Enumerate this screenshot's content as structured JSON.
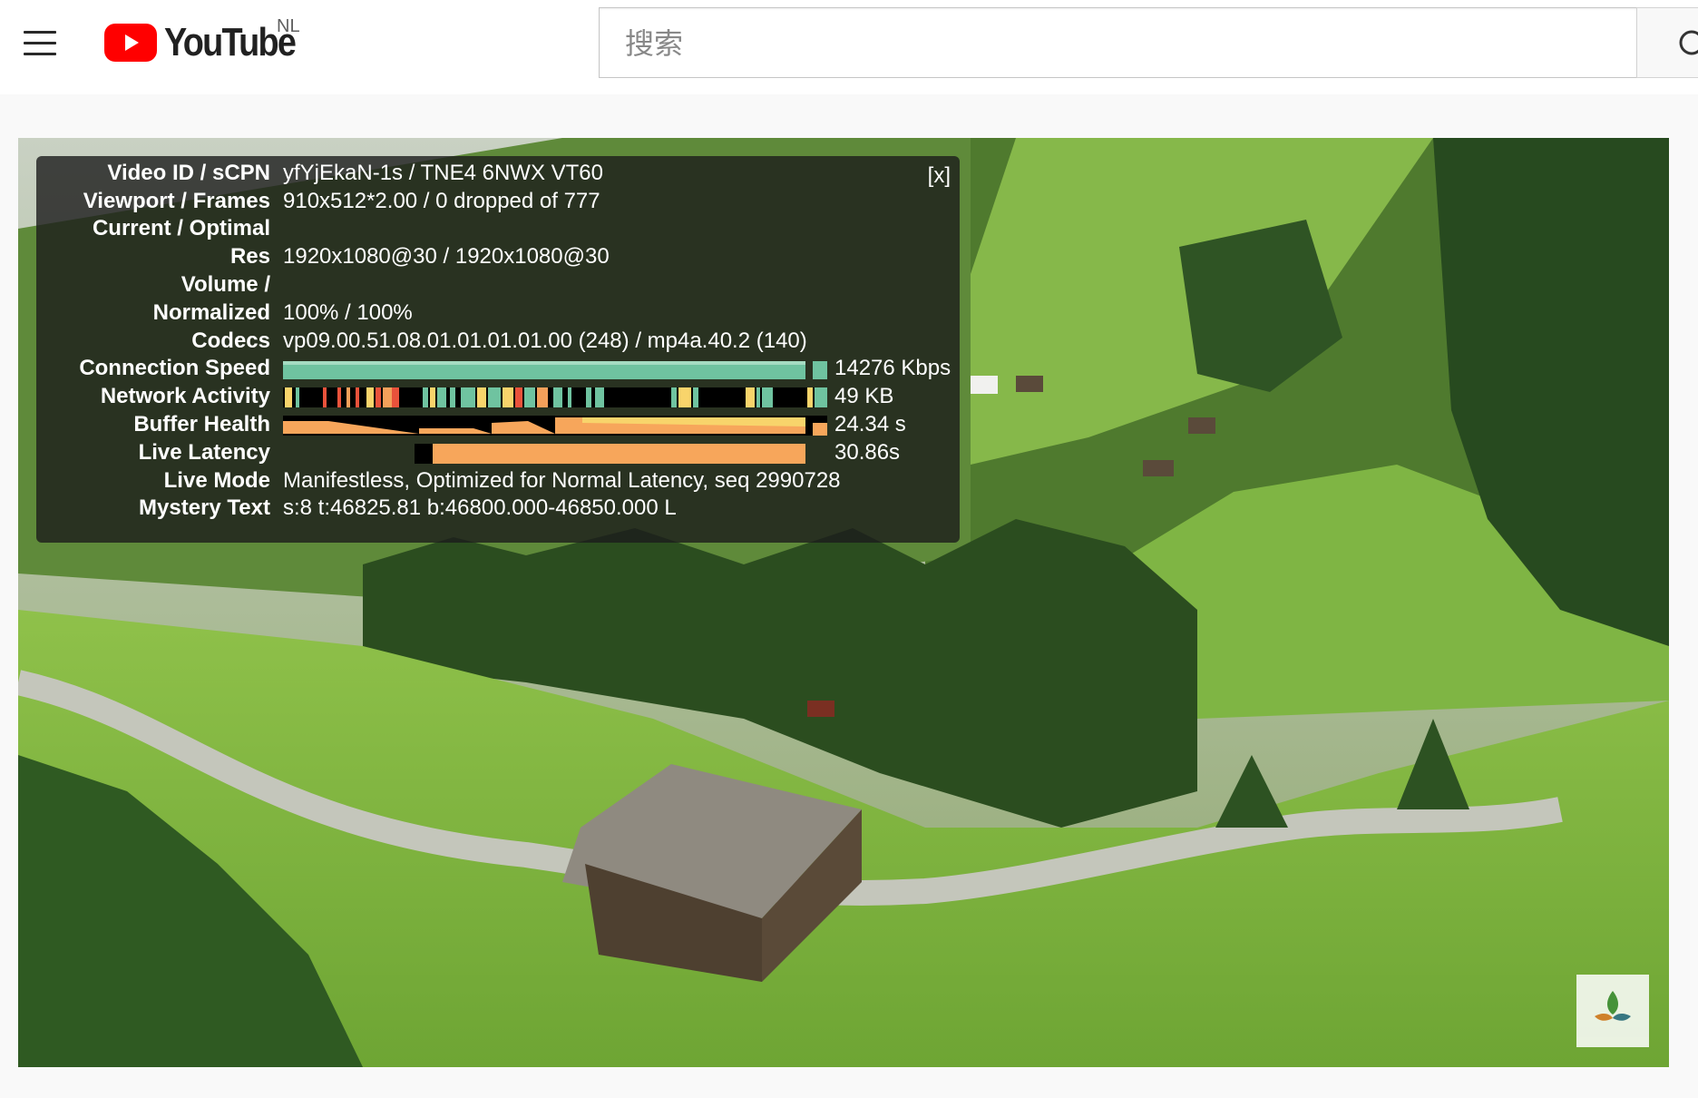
{
  "header": {
    "logo_text": "YouTube",
    "region": "NL",
    "search_placeholder": "搜索",
    "brand_color": "#FF0000"
  },
  "stats": {
    "close_label": "[x]",
    "rows": [
      {
        "label": "Video ID / sCPN",
        "value": "yfYjEkaN-1s / TNE4 6NWX VT60"
      },
      {
        "label": "Viewport / Frames",
        "value": "910x512*2.00 / 0 dropped of 777"
      },
      {
        "label": "Current / Optimal",
        "value": ""
      },
      {
        "label": "Res",
        "value": "1920x1080@30 / 1920x1080@30"
      },
      {
        "label": "Volume /",
        "value": ""
      },
      {
        "label": "Normalized",
        "value": "100% / 100%"
      },
      {
        "label": "Codecs",
        "value": "vp09.00.51.08.01.01.01.01.00 (248) / mp4a.40.2 (140)"
      },
      {
        "label": "Connection Speed",
        "value": "14276 Kbps"
      },
      {
        "label": "Network Activity",
        "value": "49 KB"
      },
      {
        "label": "Buffer Health",
        "value": "24.34 s"
      },
      {
        "label": "Live Latency",
        "value": "30.86s"
      },
      {
        "label": "Live Mode",
        "value": "Manifestless, Optimized for Normal Latency, seq 2990728"
      },
      {
        "label": "Mystery Text",
        "value": "s:8 t:46825.81 b:46800.000-46850.000 L"
      }
    ],
    "graph_colors": {
      "connection": "#6fc3a0",
      "network": [
        "#f8d46b",
        "#e9523b",
        "#6fc3a0",
        "#f4a05a"
      ],
      "buffer": "#f7a65b",
      "latency": "#f7a65b"
    }
  }
}
